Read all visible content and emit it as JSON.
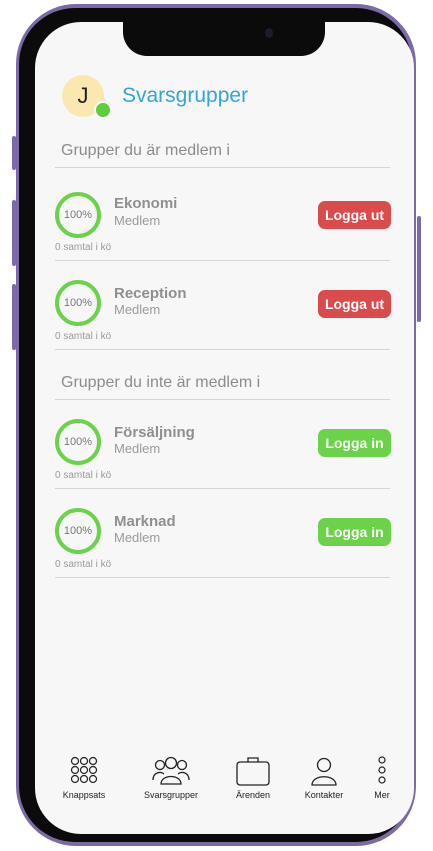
{
  "header": {
    "avatar_initial": "J",
    "title": "Svarsgrupper"
  },
  "sections": {
    "member_heading": "Grupper du är medlem i",
    "nonmember_heading": "Grupper du inte är medlem i"
  },
  "groups": [
    {
      "name": "Ekonomi",
      "role": "Medlem",
      "percent": "100%",
      "queue": "0 samtal i kö",
      "action": "Logga ut"
    },
    {
      "name": "Reception",
      "role": "Medlem",
      "percent": "100%",
      "queue": "0 samtal i kö",
      "action": "Logga ut"
    },
    {
      "name": "Försäljning",
      "role": "Medlem",
      "percent": "100%",
      "queue": "0 samtal i kö",
      "action": "Logga in"
    },
    {
      "name": "Marknad",
      "role": "Medlem",
      "percent": "100%",
      "queue": "0 samtal i kö",
      "action": "Logga in"
    }
  ],
  "nav": [
    {
      "label": "Knappsats",
      "icon": "keypad-icon"
    },
    {
      "label": "Svarsgrupper",
      "icon": "group-icon"
    },
    {
      "label": "Ärenden",
      "icon": "briefcase-icon"
    },
    {
      "label": "Kontakter",
      "icon": "contact-icon"
    },
    {
      "label": "Mer",
      "icon": "more-icon"
    }
  ],
  "colors": {
    "title": "#33a6d6",
    "logout": "#da4b4b",
    "login": "#6cd24a",
    "progress_ring": "#6ad24b",
    "presence": "#5ccf3a",
    "frame": "#7c6aa8"
  }
}
